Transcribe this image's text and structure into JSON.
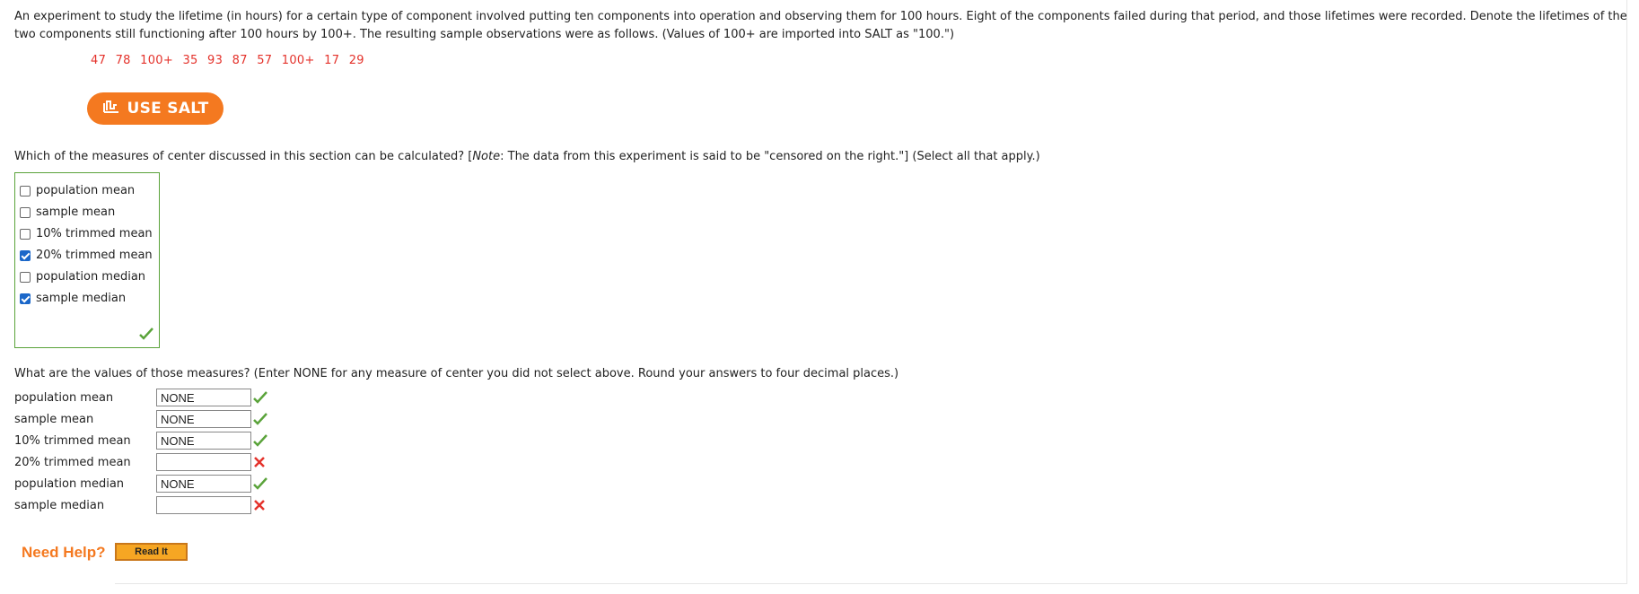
{
  "intro": {
    "text": "An experiment to study the lifetime (in hours) for a certain type of component involved putting ten components into operation and observing them for 100 hours. Eight of the components failed during that period, and those lifetimes were recorded. Denote the lifetimes of the two components still functioning after 100 hours by 100+. The resulting sample observations were as follows. (Values of 100+ are imported into SALT as \"100.\")"
  },
  "data_values": "47 78 100+ 35 93 87 57 100+ 17 29",
  "salt_button": {
    "label": "USE SALT",
    "icon": "salt-chart-icon"
  },
  "question1": {
    "prefix": "Which of the measures of center discussed in this section can be calculated? [",
    "note_label": "Note",
    "suffix": ": The data from this experiment is said to be \"censored on the right.\"] (Select all that apply.)"
  },
  "choices": [
    {
      "label": "population mean",
      "checked": false
    },
    {
      "label": "sample mean",
      "checked": false
    },
    {
      "label": "10% trimmed mean",
      "checked": false
    },
    {
      "label": "20% trimmed mean",
      "checked": true
    },
    {
      "label": "population median",
      "checked": false
    },
    {
      "label": "sample median",
      "checked": true
    }
  ],
  "question2": "What are the values of those measures? (Enter NONE for any measure of center you did not select above. Round your answers to four decimal places.)",
  "answers": [
    {
      "label": "population mean",
      "value": "NONE",
      "status": "correct"
    },
    {
      "label": "sample mean",
      "value": "NONE",
      "status": "correct"
    },
    {
      "label": "10% trimmed mean",
      "value": "NONE",
      "status": "correct"
    },
    {
      "label": "20% trimmed mean",
      "value": "",
      "status": "incorrect"
    },
    {
      "label": "population median",
      "value": "NONE",
      "status": "correct"
    },
    {
      "label": "sample median",
      "value": "",
      "status": "incorrect"
    }
  ],
  "help": {
    "label": "Need Help?",
    "read_it": "Read It"
  },
  "colors": {
    "accent": "#f47920",
    "correct": "#5aa33a",
    "incorrect": "#e4322b",
    "data_red": "#e4322b",
    "checkbox_blue": "#1b67c9"
  }
}
